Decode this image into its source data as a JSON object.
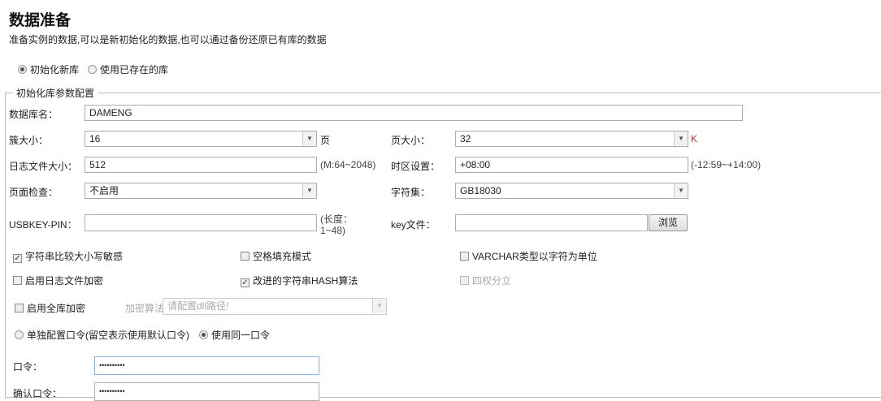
{
  "header": {
    "title": "数据准备",
    "subtitle": "准备实例的数据,可以是新初始化的数据,也可以通过备份还原已有库的数据"
  },
  "mode": {
    "options": [
      "初始化新库",
      "使用已存在的库"
    ],
    "selected": 0
  },
  "section": {
    "legend": "初始化库参数配置"
  },
  "fields": {
    "db_name": {
      "label": "数据库名：",
      "value": "DAMENG"
    },
    "extent_size": {
      "label": "簇大小：",
      "value": "16",
      "unit": "页"
    },
    "page_size": {
      "label": "页大小：",
      "value": "32",
      "unit": "K"
    },
    "log_size": {
      "label": "日志文件大小：",
      "value": "512",
      "hint": "(M:64~2048)"
    },
    "time_zone": {
      "label": "时区设置：",
      "value": "+08:00",
      "hint": "(-12:59~+14:00)"
    },
    "page_check": {
      "label": "页面检查：",
      "value": "不启用"
    },
    "charset": {
      "label": "字符集：",
      "value": "GB18030"
    },
    "usbkey": {
      "label": "USBKEY-PIN：",
      "value": "",
      "hint1": "(长度：",
      "hint2": "1~48)"
    },
    "key_file": {
      "label": "key文件：",
      "value": "",
      "browse": "浏览"
    }
  },
  "checkboxes": [
    {
      "label": "字符串比较大小写敏感",
      "checked": true
    },
    {
      "label": "空格填充模式",
      "checked": false
    },
    {
      "label": "VARCHAR类型以字符为单位",
      "checked": false
    },
    {
      "label": "启用日志文件加密",
      "checked": false
    },
    {
      "label": "改进的字符串HASH算法",
      "checked": true
    },
    {
      "label": "四权分立",
      "checked": false,
      "disabled": true
    },
    {
      "label": "启用全库加密",
      "checked": false
    }
  ],
  "encrypt": {
    "label": "加密算法：",
    "placeholder": "请配置dll路径!"
  },
  "password_mode": {
    "options": [
      "单独配置口令(留空表示使用默认口令)",
      "使用同一口令"
    ],
    "selected": 1
  },
  "password": {
    "label": "口令：",
    "value": "••••••••••"
  },
  "confirm": {
    "label": "确认口令：",
    "value": "••••••••••"
  }
}
